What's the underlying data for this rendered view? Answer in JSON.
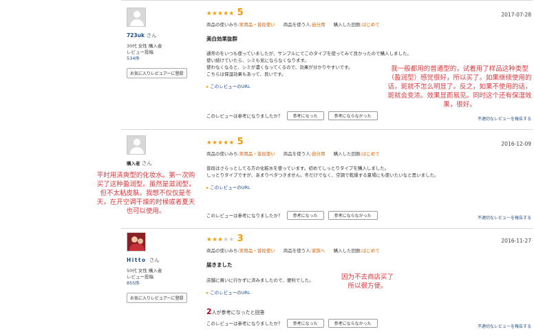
{
  "common": {
    "san": "さん",
    "attr_usage_label": "商品の使いみち:",
    "attr_user_label": "商品を使う人:",
    "attr_times_label": "購入した回数:",
    "helpful_question": "このレビューは参考になりましたか？",
    "helpful_yes": "参考になった",
    "helpful_no": "参考にならなかった",
    "report": "不適切なレビューを報告する",
    "review_url": "このレビューのURL",
    "favorite_btn": "お気に入りレビュアーに登録"
  },
  "reviews": [
    {
      "user": {
        "name": "723uk",
        "meta": "30代 女性  購入者",
        "meta2": "レビュー投稿",
        "count": "534件"
      },
      "stars": "★★★★★",
      "stars_off": "",
      "score": "5",
      "date": "2017-07-28",
      "usage": "実用品・普段使い",
      "user_type": "自分用",
      "times": "はじめて",
      "title": "美白効果抜群",
      "lines": [
        "通常のをいつも使っていましたが、サンプルにてこのタイプを使ってみて良かったので購入しました。",
        "使い続けていたら、シミも気にならなくなります。",
        "使わなくなると、シミが濃くなってくるので、効果が分かりやすいです。",
        "こちらは保湿効果もあって、良いです。"
      ]
    },
    {
      "user": {
        "name": "購入者"
      },
      "stars": "★★★★★",
      "stars_off": "",
      "score": "5",
      "date": "2016-12-09",
      "usage": "実用品・普段使い",
      "user_type": "自分用",
      "times": "はじめて",
      "lines": [
        "普段はさらっとしてる方の化粧水を使っています。初めてしっとりタイプを購入しました。",
        "しっとりタイプですが、あまりベタつきません。冬だけでなく、空調で乾燥する夏場にも使いたいなと思いました。"
      ]
    },
    {
      "user": {
        "name": "Hitto",
        "meta": "50代 女性  購入者",
        "meta2": "レビュー投稿",
        "count": "855件"
      },
      "stars": "★★★",
      "stars_off": "★★",
      "score": "3",
      "date": "2016-11-27",
      "usage": "実用品・普段使い",
      "user_type": "家族へ",
      "times": "はじめて",
      "title": "届きました",
      "lines": [
        "店舗に買いに行かずに済みましたので、便利でした。"
      ],
      "helpful_count": "2",
      "helpful_count_suffix": "人が参考になったと回答"
    }
  ],
  "annotations": {
    "note1": "我一般都用的普通型的，试着用了样品这种类型（盈润型）感觉很好，所以买了。如果继续使用的话，斑就不怎么明显了。反之，如果不使用的话，斑就会变浓。效果显而易见。同时这个还有保湿效果，很好。",
    "note2": "平时用清爽型的化妆水。第一次购买了这种盈润型。虽然是滋润型，但不太粘皮肤。我想不仅仅是冬天，在开空调干燥的时候或者夏天也可以使用。",
    "note3": "因为不去商店买了所以很方便。"
  }
}
